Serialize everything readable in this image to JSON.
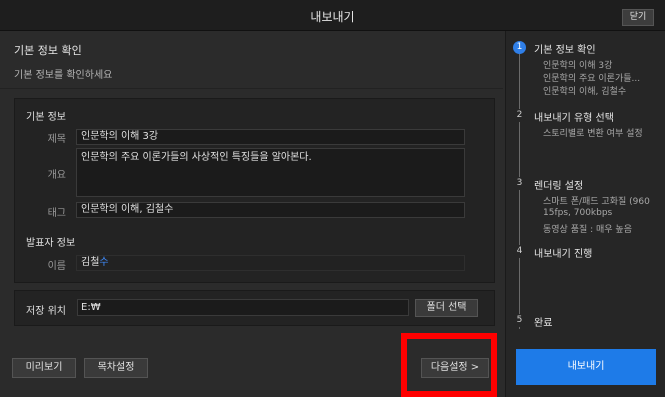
{
  "window": {
    "title": "내보내기",
    "close_label": "닫기"
  },
  "section": {
    "title": "기본 정보 확인",
    "subtitle": "기본 정보를 확인하세요"
  },
  "basic_info": {
    "heading": "기본 정보",
    "title_label": "제목",
    "title_value": "인문학의 이해 3강",
    "summary_label": "개요",
    "summary_value": "인문학의 주요 이론가들의 사상적인 특징들을 알아본다.",
    "tag_label": "태그",
    "tag_value": "인문학의 이해, 김철수"
  },
  "presenter": {
    "heading": "발표자 정보",
    "name_label": "이름",
    "name_value_main": "김철",
    "name_value_accent": "수"
  },
  "save": {
    "label": "저장 위치",
    "path": "E:₩",
    "folder_button": "폴더 선택"
  },
  "footer": {
    "preview_button": "미리보기",
    "toc_button": "목차설정",
    "next_button": "다음설정 >"
  },
  "steps": [
    {
      "number": "1",
      "title": "기본 정보 확인",
      "details": [
        "인문학의 이해 3강",
        "인문학의 주요 이론가들...",
        "인문학의 이해, 김철수"
      ]
    },
    {
      "number": "2",
      "title": "내보내기 유형 선택",
      "details": [
        "스토리별로 변환 여부 설정"
      ]
    },
    {
      "number": "3",
      "title": "렌더링 설정",
      "details": [
        "스마트 폰/패드 고화질 (960",
        "15fps, 700kbps",
        "동영상 품질 : 매우 높음"
      ]
    },
    {
      "number": "4",
      "title": "내보내기 진행",
      "details": []
    },
    {
      "number": "5",
      "title": "완료",
      "details": []
    }
  ],
  "export_button": "내보내기",
  "colors": {
    "accent": "#2f7fe8",
    "highlight": "#ff0000"
  }
}
